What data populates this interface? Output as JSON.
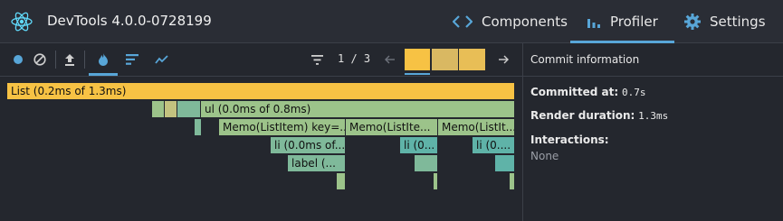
{
  "app": {
    "title": "DevTools 4.0.0-0728199"
  },
  "tabs": [
    {
      "label": "Components",
      "icon": "code-icon"
    },
    {
      "label": "Profiler",
      "icon": "bar-chart-icon"
    },
    {
      "label": "Settings",
      "icon": "gear-icon"
    }
  ],
  "toolbar": {
    "commit_counter": "1 / 3",
    "commits": [
      {
        "selected": true
      },
      {
        "selected": false
      },
      {
        "selected": false
      }
    ]
  },
  "colors": {
    "accent": "#58a6d8",
    "record": "#58a6d8",
    "root_bar": "#f7c244",
    "commit": "#e8be56",
    "flame_green_light": "#9cc38a",
    "flame_green": "#7fb99a",
    "flame_teal": "#5fb3a8"
  },
  "flame": {
    "root": "List (0.2ms of 1.3ms)",
    "ul": "ul (0.0ms of 0.8ms)",
    "memo_items": [
      "Memo(ListItem) key=...",
      "Memo(ListIte...",
      "Memo(ListIt..."
    ],
    "li_items": [
      "li (0.0ms of...",
      "li (0...",
      "li (0...."
    ],
    "label_item": "label (..."
  },
  "sidebar": {
    "title": "Commit information",
    "committed_at_label": "Committed at:",
    "committed_at_value": "0.7s",
    "render_duration_label": "Render duration:",
    "render_duration_value": "1.3ms",
    "interactions_label": "Interactions:",
    "interactions_value": "None"
  }
}
